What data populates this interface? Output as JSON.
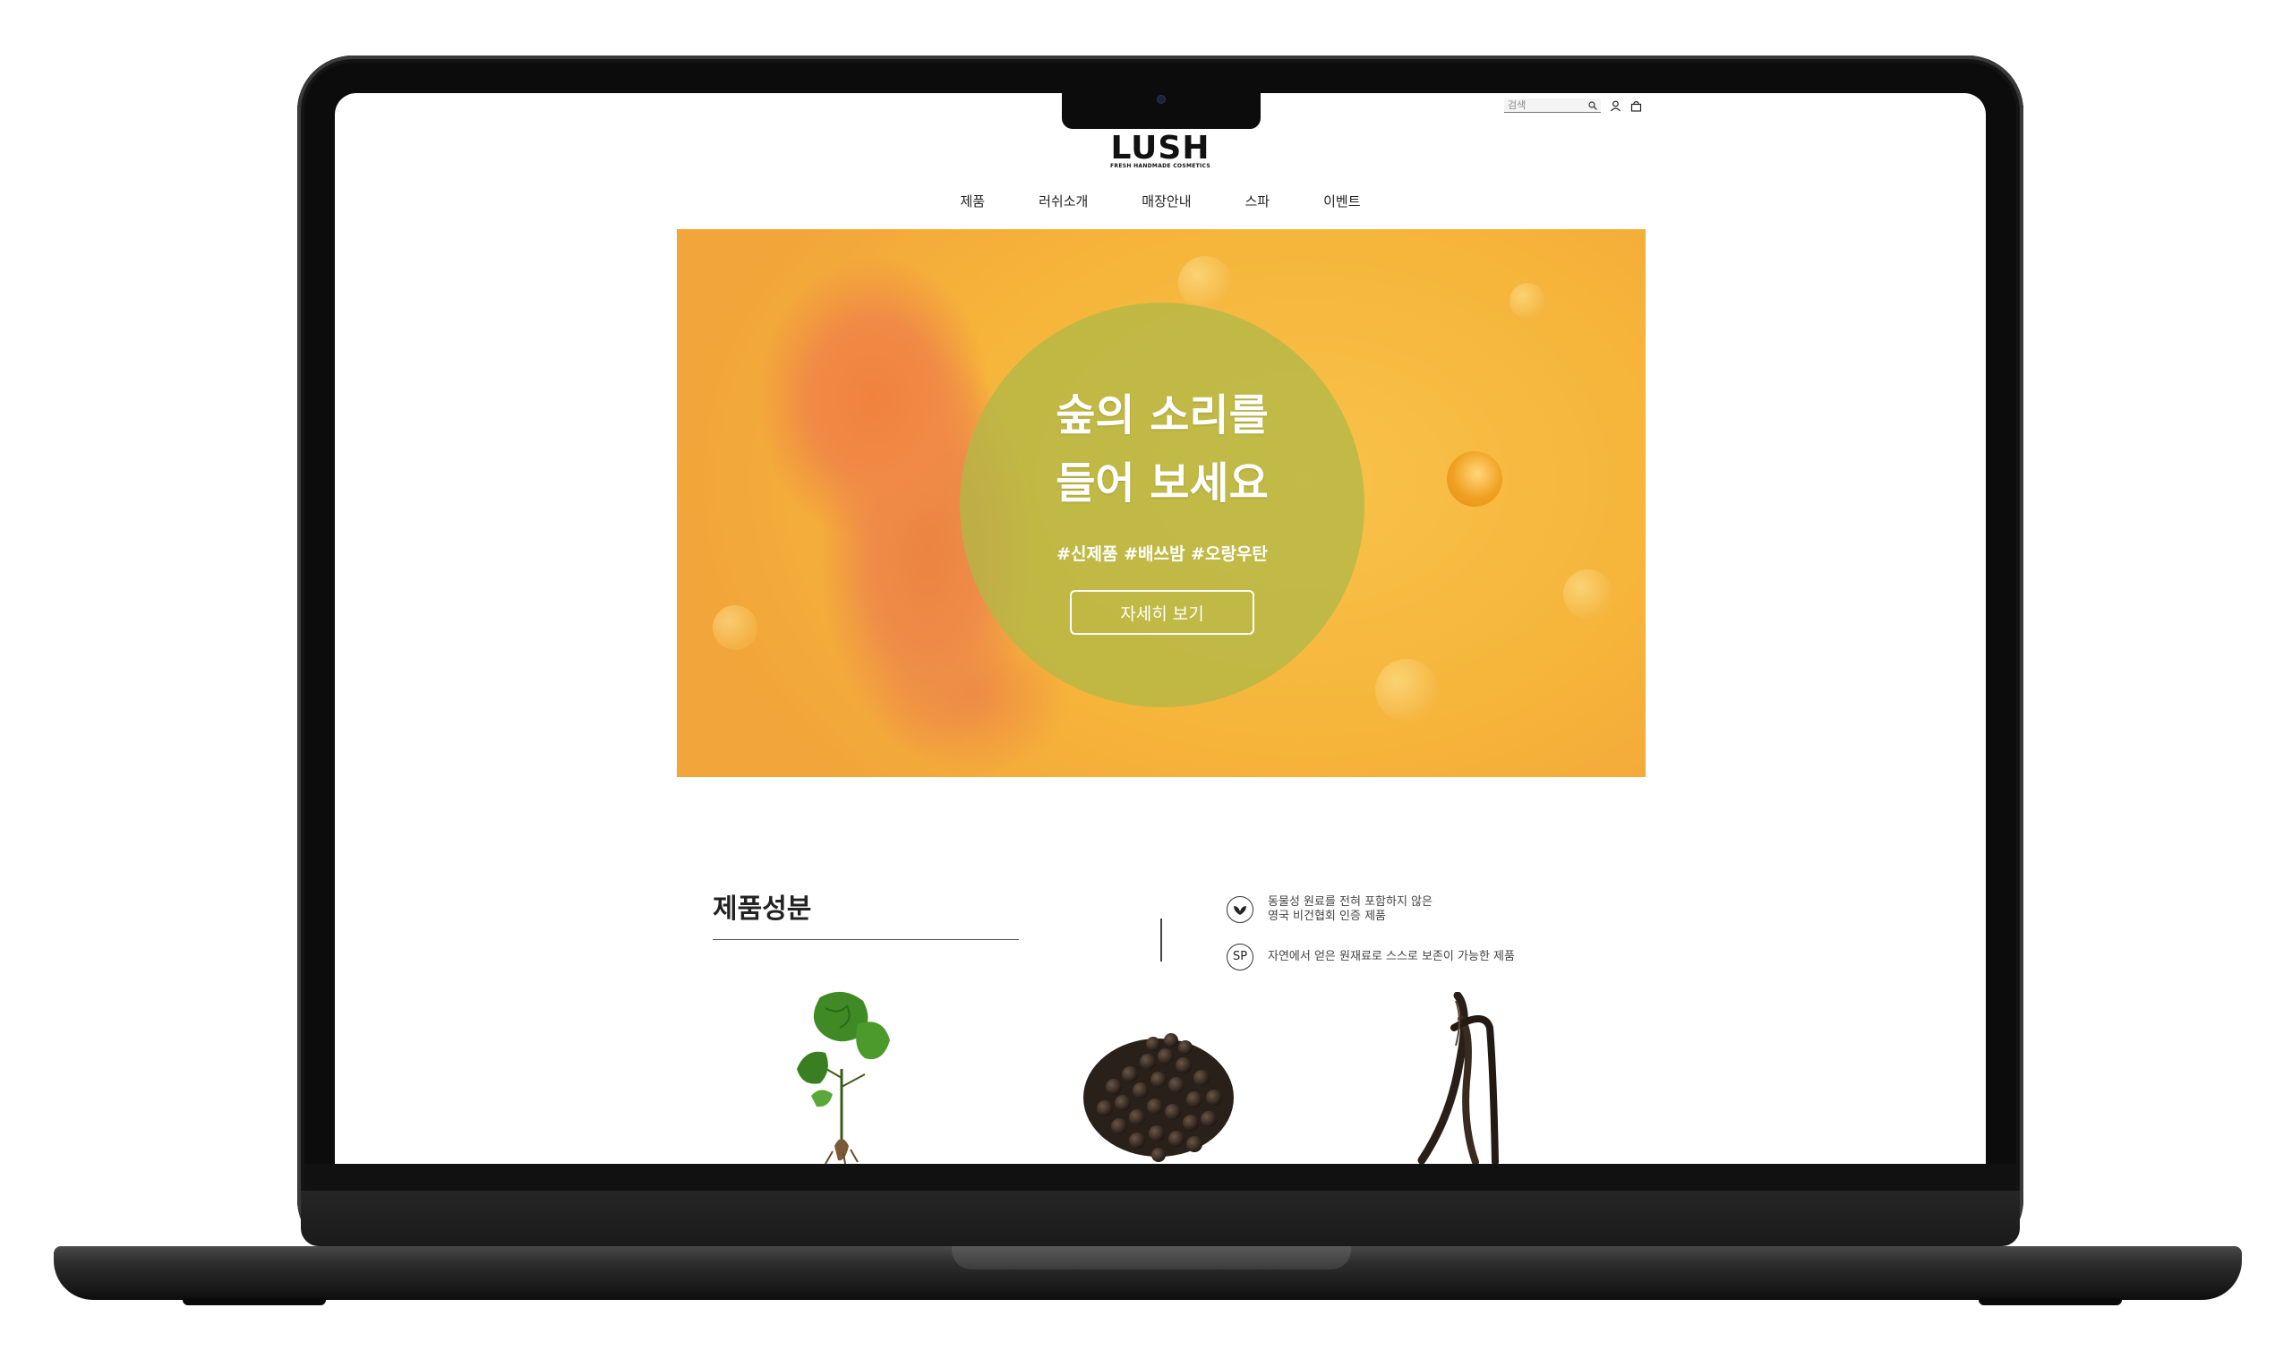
{
  "header": {
    "search_placeholder": "검색",
    "logo": "LUSH",
    "logo_tagline": "FRESH HANDMADE COSMETICS",
    "icons": [
      "search-icon",
      "user-icon",
      "shopping-bag-icon"
    ]
  },
  "nav": {
    "items": [
      {
        "label": "제품"
      },
      {
        "label": "러쉬소개"
      },
      {
        "label": "매장안내"
      },
      {
        "label": "스파"
      },
      {
        "label": "이벤트"
      }
    ]
  },
  "hero": {
    "title_line1": "숲의 소리를",
    "title_line2": "들어 보세요",
    "tags": "#신제품 #배쓰밤 #오랑우탄",
    "cta": "자세히 보기"
  },
  "ingredients": {
    "title": "제품성분",
    "legend": [
      {
        "icon": "vegan-leaf-icon",
        "line1": "동물성 원료를 전혀 포함하지 않은",
        "line2": "영국 비건협회 인증 제품"
      },
      {
        "icon": "sp-badge-icon",
        "badge": "SP",
        "line1": "자연에서 얻은 원재료로 스스로 보존이 가능한 제품"
      }
    ],
    "items": [
      "plant-image",
      "peppercorn-image",
      "vanilla-pod-image"
    ]
  },
  "colors": {
    "hero_circle": "#b2b846",
    "hero_background": "#f6b43a",
    "bath_bomb": "#ee8c48",
    "text_dark": "#222222"
  }
}
